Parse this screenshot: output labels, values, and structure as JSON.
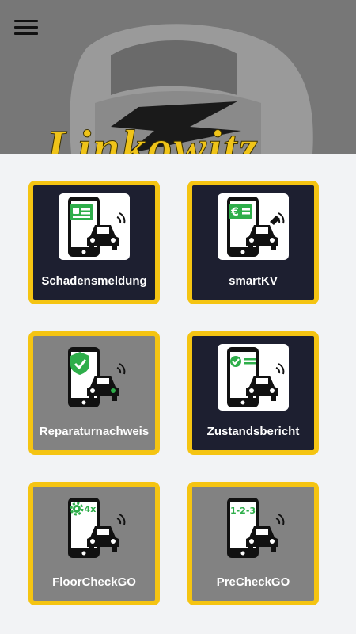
{
  "header": {
    "brand": "Linkowitz",
    "menu_icon": "hamburger-menu-icon"
  },
  "tiles": [
    {
      "label": "Schadensmeldung",
      "icon": "phone-id-card-car-icon",
      "style": "dark"
    },
    {
      "label": "smartKV",
      "icon": "phone-euro-car-icon",
      "style": "dark"
    },
    {
      "label": "Reparaturnachweis",
      "icon": "phone-shield-check-car-icon",
      "style": "grey"
    },
    {
      "label": "Zustandsbericht",
      "icon": "phone-checkmark-car-icon",
      "style": "dark"
    },
    {
      "label": "FloorCheckGO",
      "icon": "phone-gear-4x-car-icon",
      "style": "grey"
    },
    {
      "label": "PreCheckGO",
      "icon": "phone-1-2-3-car-icon",
      "style": "grey"
    }
  ],
  "colors": {
    "accent_yellow": "#f5c412",
    "tile_dark": "#1d1f30",
    "tile_grey": "#828282",
    "icon_green": "#2eae4a",
    "background": "#f2f3f5"
  },
  "icon_glyphs": {
    "euro": "€",
    "multiplier": "4x",
    "steps": "1-2-3"
  }
}
